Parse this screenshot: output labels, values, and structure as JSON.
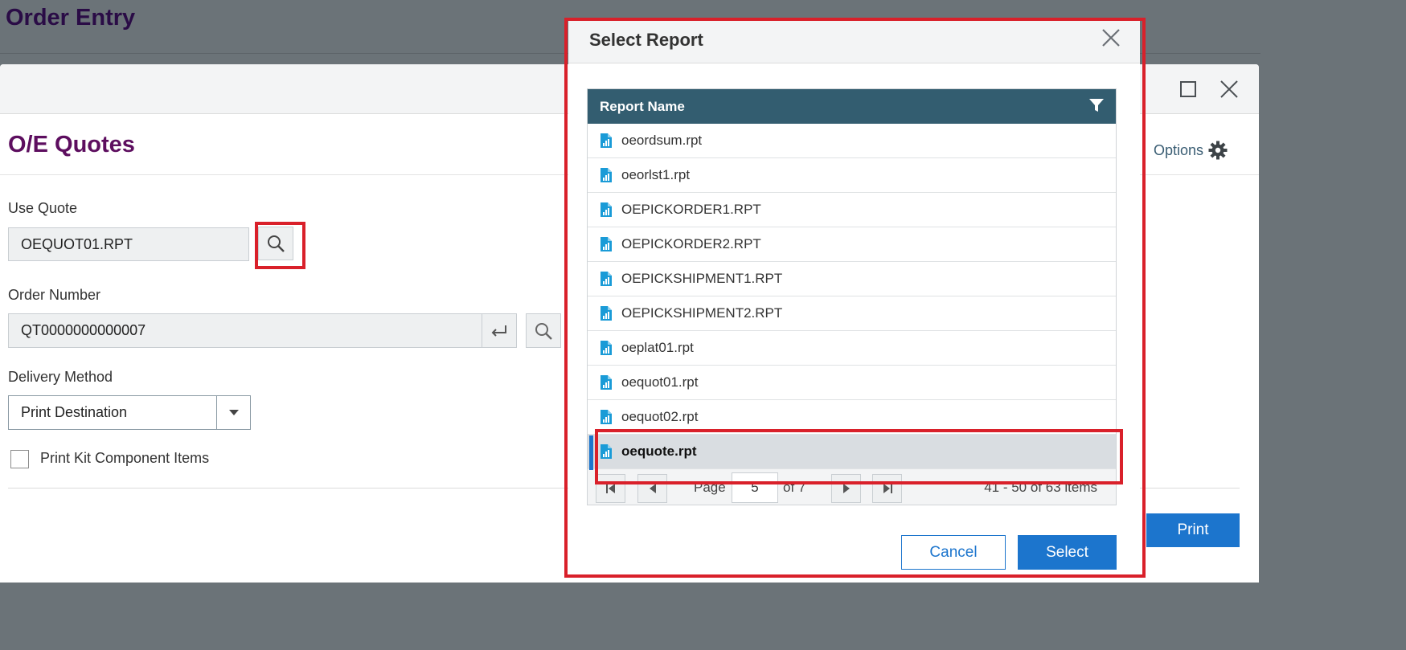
{
  "app": {
    "title": "Order Entry"
  },
  "window": {
    "title": "O/E Quotes",
    "options_label": "Options"
  },
  "form": {
    "use_quote": {
      "label": "Use Quote",
      "value": "OEQUOT01.RPT"
    },
    "order_number": {
      "label": "Order Number",
      "value": "QT0000000000007"
    },
    "delivery_method": {
      "label": "Delivery Method",
      "value": "Print Destination"
    },
    "print_kit": {
      "label": "Print Kit Component Items",
      "checked": false
    },
    "print_button": "Print"
  },
  "modal": {
    "title": "Select Report",
    "column_header": "Report Name",
    "rows": [
      {
        "name": "oeordsum.rpt"
      },
      {
        "name": "oeorlst1.rpt"
      },
      {
        "name": "OEPICKORDER1.RPT"
      },
      {
        "name": "OEPICKORDER2.RPT"
      },
      {
        "name": "OEPICKSHIPMENT1.RPT"
      },
      {
        "name": "OEPICKSHIPMENT2.RPT"
      },
      {
        "name": "oeplat01.rpt"
      },
      {
        "name": "oequot01.rpt"
      },
      {
        "name": "oequot02.rpt"
      },
      {
        "name": "oequote.rpt"
      }
    ],
    "selected_row": "oequote.rpt",
    "pager": {
      "page_label": "Page",
      "current_page": "5",
      "of_label": "of 7",
      "summary": "41 - 50 of 63 items"
    },
    "cancel_label": "Cancel",
    "select_label": "Select"
  },
  "colors": {
    "accent": "#1c75cd",
    "grid_header": "#335d70",
    "title_purple": "#5d0e5f",
    "highlight_red": "#d9202a",
    "row_icon": "#1a9bd7"
  }
}
